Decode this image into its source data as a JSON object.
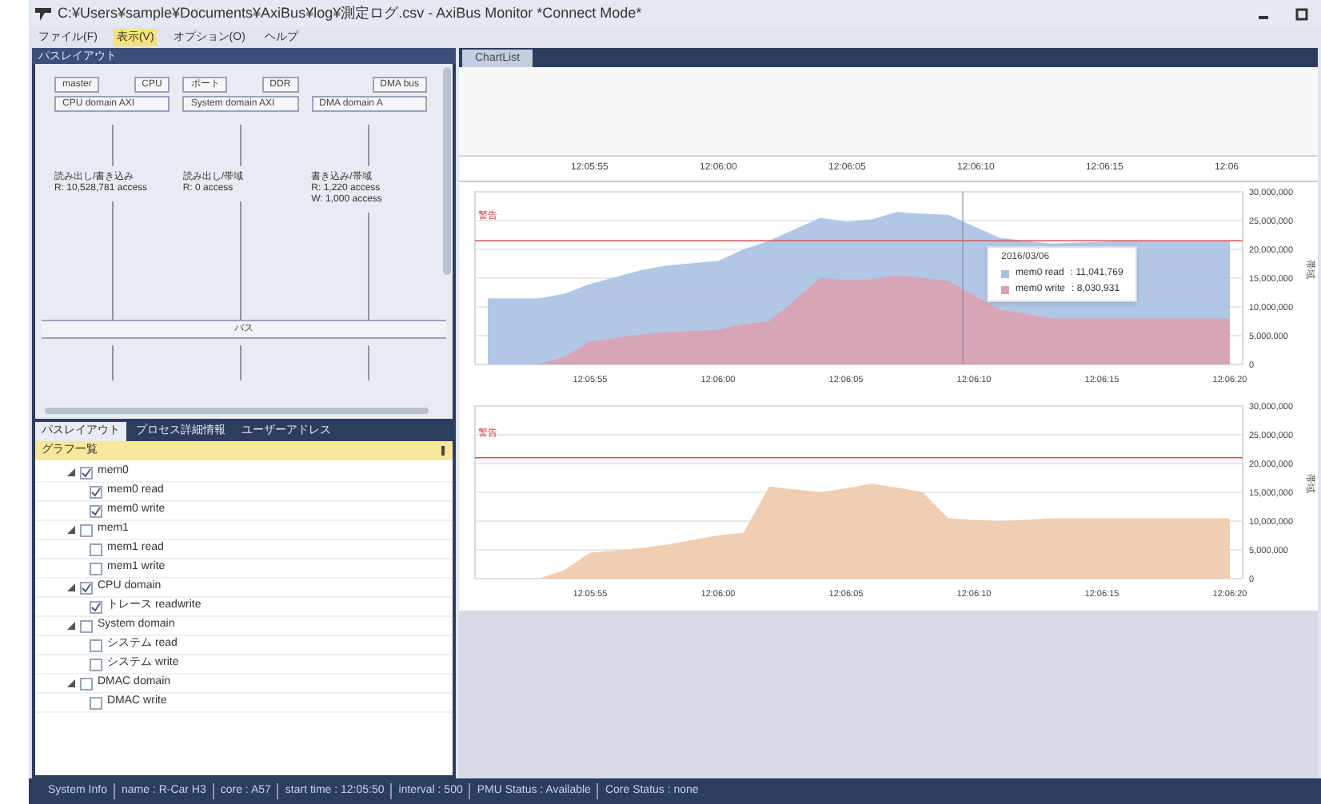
{
  "window": {
    "title": "C:¥Users¥sample¥Documents¥AxiBus¥log¥測定ログ.csv - AxiBus Monitor *Connect Mode*"
  },
  "menu": [
    {
      "label": "ファイル(F)",
      "selected": false
    },
    {
      "label": "表示(V)",
      "selected": true
    },
    {
      "label": "オプション(O)",
      "selected": false
    },
    {
      "label": "ヘルプ",
      "selected": false
    }
  ],
  "left_panel": {
    "title": "パスレイアウト",
    "diagram": {
      "columns": [
        {
          "boxes": [
            "master",
            "CPU"
          ],
          "domain": "CPU domain AXI",
          "stats": [
            "読み出し/書き込み",
            "R: 10,528,781 access"
          ]
        },
        {
          "boxes": [
            "ポート",
            "DDR"
          ],
          "domain": "System domain AXI",
          "stats": [
            "読み出し/帯域",
            "R: 0 access"
          ]
        },
        {
          "boxes": [
            "DMA bus"
          ],
          "domain": "DMA domain A",
          "stats": [
            "書き込み/帯域",
            "R: 1,220 access",
            "W: 1,000 access"
          ]
        }
      ],
      "bus": "バス"
    },
    "tabs": [
      {
        "label": "パスレイアウト",
        "selected": true
      },
      {
        "label": "プロセス詳細情報",
        "selected": false
      },
      {
        "label": "ユーザーアドレス",
        "selected": false
      }
    ],
    "tree": {
      "header": "グラフ一覧",
      "items": [
        {
          "label": "mem0",
          "checked": true,
          "expanded": true,
          "children": [
            {
              "label": "mem0 read",
              "checked": true
            },
            {
              "label": "mem0 write",
              "checked": true
            }
          ]
        },
        {
          "label": "mem1",
          "checked": false,
          "expanded": true,
          "children": [
            {
              "label": "mem1 read",
              "checked": false
            },
            {
              "label": "mem1 write",
              "checked": false
            }
          ]
        },
        {
          "label": "CPU domain",
          "checked": true,
          "expanded": true,
          "children": [
            {
              "label": "トレース readwrite",
              "checked": true
            }
          ]
        },
        {
          "label": "System domain",
          "checked": false,
          "expanded": true,
          "children": [
            {
              "label": "システム read",
              "checked": false
            },
            {
              "label": "システム write",
              "checked": false
            }
          ]
        },
        {
          "label": "DMAC domain",
          "checked": false,
          "expanded": true,
          "children": [
            {
              "label": "DMAC write",
              "checked": false
            }
          ]
        }
      ]
    }
  },
  "right_panel": {
    "tab": "ChartList",
    "time_ruler": [
      "12:05:55",
      "12:06:00",
      "12:06:05",
      "12:06:10",
      "12:06:15",
      "12:06"
    ],
    "charts": [
      {
        "chart_data": {
          "type": "area",
          "ylabel": "帯域",
          "categories": [
            null,
            null,
            null,
            null,
            "12:05:55",
            null,
            null,
            null,
            null,
            "12:06:00",
            null,
            null,
            null,
            null,
            "12:06:05",
            null,
            null,
            null,
            null,
            "12:06:10",
            null,
            null,
            null,
            null,
            "12:06:15",
            null,
            null,
            null,
            null,
            "12:06:20"
          ],
          "ylim": [
            0,
            30000000
          ],
          "yticks": [
            {
              "value": 0,
              "label": "0"
            },
            {
              "value": 5000000,
              "label": "5,000,000"
            },
            {
              "value": 10000000,
              "label": "10,000,000"
            },
            {
              "value": 15000000,
              "label": "15,000,000"
            },
            {
              "value": 20000000,
              "label": "20,000,000"
            },
            {
              "value": 25000000,
              "label": "25,000,000"
            },
            {
              "value": 30000000,
              "label": "30,000,000"
            }
          ],
          "series": [
            {
              "name": "mem0 read",
              "color": "#a9c1e2",
              "values": [
                11500000,
                11500000,
                11500000,
                12300000,
                14000000,
                15200000,
                16400000,
                17200000,
                17600000,
                18000000,
                20000000,
                21500000,
                23500000,
                25500000,
                24800000,
                25200000,
                26500000,
                26200000,
                26000000,
                24000000,
                22000000,
                21500000,
                21000000,
                21200000,
                21300000,
                21500000,
                21500000,
                21500000,
                21500000,
                21500000
              ]
            },
            {
              "name": "mem0 write",
              "color": "#dba0b2",
              "values": [
                0,
                0,
                0,
                1300000,
                4000000,
                4600000,
                5200000,
                5600000,
                5800000,
                6000000,
                7000000,
                7500000,
                11200000,
                15000000,
                14700000,
                14800000,
                15500000,
                15000000,
                14500000,
                12000000,
                9500000,
                8800000,
                8000000,
                8000000,
                8000000,
                8000000,
                8000000,
                8000000,
                8000000,
                8000000
              ]
            }
          ],
          "grid": true,
          "legend": "right",
          "ref_lines": [
            {
              "axis": "y",
              "value": 21500000,
              "label": "警告"
            }
          ]
        },
        "tooltip": {
          "title": "2016/03/06",
          "rows": [
            ": 11,041,769",
            ": 8,030,931"
          ]
        }
      },
      {
        "chart_data": {
          "type": "area",
          "ylabel": "帯域",
          "categories": [
            null,
            null,
            null,
            null,
            "12:05:55",
            null,
            null,
            null,
            null,
            "12:06:00",
            null,
            null,
            null,
            null,
            "12:06:05",
            null,
            null,
            null,
            null,
            "12:06:10",
            null,
            null,
            null,
            null,
            "12:06:15",
            null,
            null,
            null,
            null,
            "12:06:20"
          ],
          "ylim": [
            0,
            30000000
          ],
          "yticks": [
            {
              "value": 0,
              "label": "0"
            },
            {
              "value": 5000000,
              "label": "5,000,000"
            },
            {
              "value": 10000000,
              "label": "10,000,000"
            },
            {
              "value": 15000000,
              "label": "15,000,000"
            },
            {
              "value": 20000000,
              "label": "20,000,000"
            },
            {
              "value": 25000000,
              "label": "25,000,000"
            },
            {
              "value": 30000000,
              "label": "30,000,000"
            }
          ],
          "series": [
            {
              "color": "#f0c8a8",
              "values": [
                0,
                0,
                0,
                1500000,
                4500000,
                4900000,
                5300000,
                5900000,
                6700000,
                7500000,
                8000000,
                16000000,
                15500000,
                15000000,
                15700000,
                16500000,
                15800000,
                15000000,
                10500000,
                10200000,
                10000000,
                10200000,
                10500000,
                10500000,
                10500000,
                10500000,
                10500000,
                10500000,
                10500000,
                10500000
              ]
            }
          ],
          "grid": true,
          "ref_lines": [
            {
              "axis": "y",
              "value": 21000000,
              "label": "警告"
            }
          ]
        }
      }
    ]
  },
  "status_bar": [
    "System Info",
    "name : R-Car H3",
    "core : A57",
    "start time : 12:05:50",
    "interval : 500",
    "PMU Status : Available",
    "Core Status : none"
  ]
}
